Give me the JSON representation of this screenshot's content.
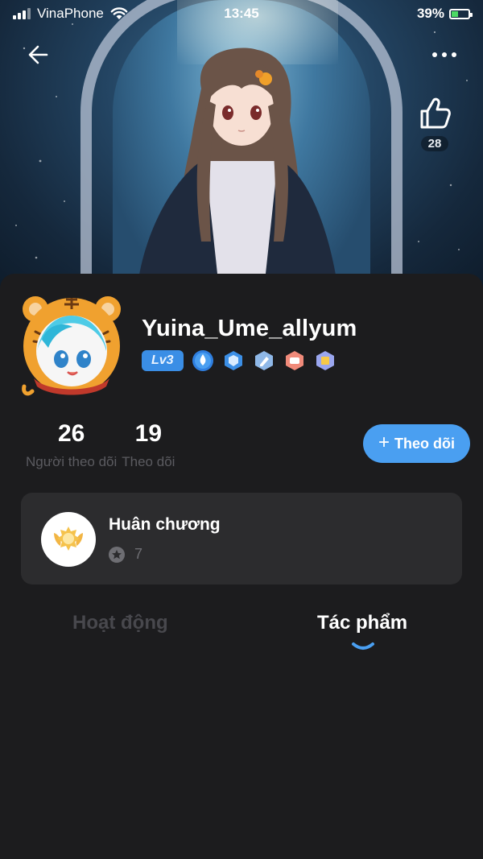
{
  "status_bar": {
    "carrier": "VinaPhone",
    "time": "13:45",
    "battery": "39%",
    "battery_level": 0.39
  },
  "header": {
    "back_icon": "arrow-left-icon",
    "more_icon": "more-dots-icon",
    "like_icon": "thumbs-up-icon",
    "like_count": "28"
  },
  "profile": {
    "username": "Yuina_Ume_allyum",
    "level": "Lv3",
    "badges": [
      "drop-badge-icon",
      "shield-badge-icon",
      "pencil-badge-icon",
      "chat-badge-icon",
      "book-badge-icon"
    ]
  },
  "stats": {
    "followers_count": "26",
    "followers_label": "Người theo dõi",
    "following_count": "19",
    "following_label": "Theo dõi"
  },
  "follow_button": {
    "plus": "+",
    "label": "Theo dõi"
  },
  "medals": {
    "title": "Huân chương",
    "count": "7"
  },
  "tabs": [
    {
      "label": "Hoạt động",
      "active": false
    },
    {
      "label": "Tác phẩm",
      "active": true
    }
  ],
  "colors": {
    "accent": "#4a9ff1",
    "background": "#1c1c1e",
    "card": "#2c2c2e",
    "muted_text": "#5b5b60"
  }
}
